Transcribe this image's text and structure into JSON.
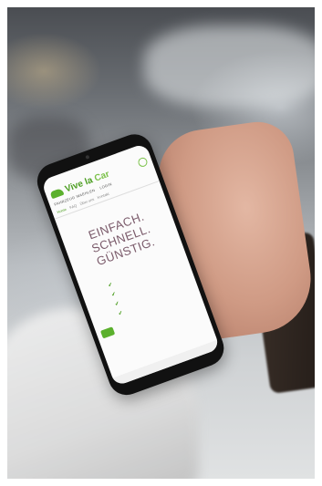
{
  "phone_screen": {
    "status_text": "",
    "brand": {
      "part1": "Vive la",
      "part2": "Car"
    },
    "nav_text": "FAHRZEUG WAEHLEN",
    "nav_text_right": "LOGIN",
    "tabs": [
      "Home",
      "FAQ",
      "Über uns",
      "Kontakt"
    ],
    "headline_lines": [
      "EINFACH.",
      "SCHNELL.",
      "GÜNSTIG."
    ],
    "checks": [],
    "cta_label": ""
  }
}
